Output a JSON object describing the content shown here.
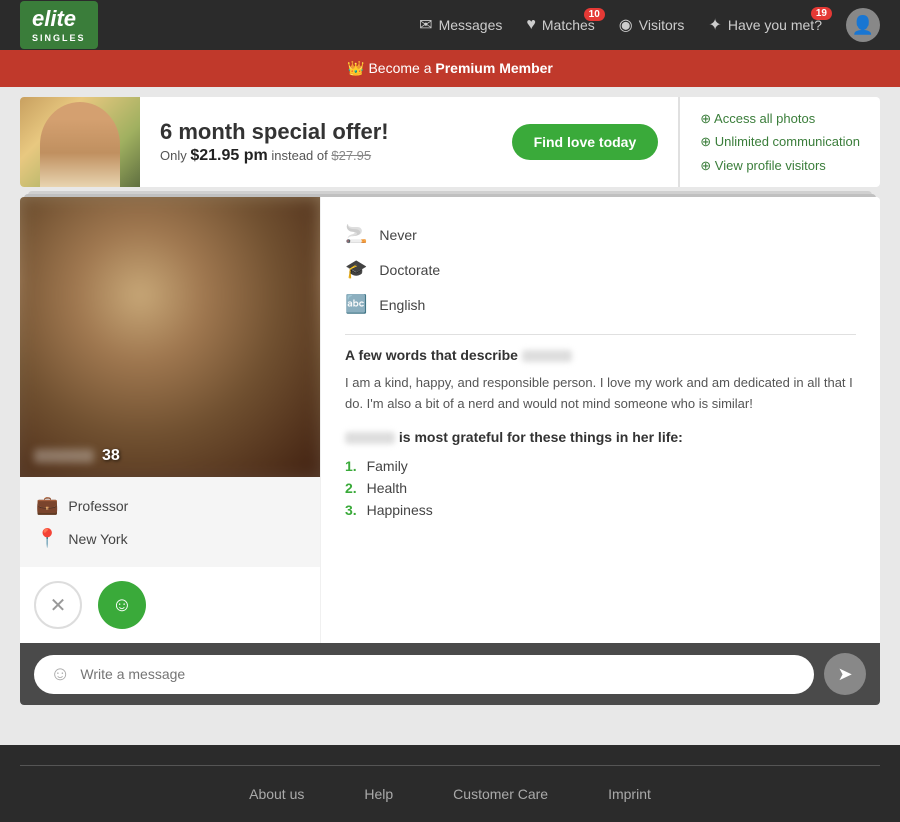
{
  "header": {
    "logo": "elite",
    "logo_sub": "SINGLES",
    "nav": [
      {
        "id": "messages",
        "label": "Messages",
        "icon": "✉",
        "badge": null
      },
      {
        "id": "matches",
        "label": "Matches",
        "icon": "♥",
        "badge": "10"
      },
      {
        "id": "visitors",
        "label": "Visitors",
        "icon": "◉",
        "badge": null
      },
      {
        "id": "have-you-met",
        "label": "Have you met?",
        "icon": "✦",
        "badge": "19"
      }
    ]
  },
  "premium_banner": {
    "text": "Become a ",
    "link_text": "Premium Member",
    "crown_icon": "👑"
  },
  "ad_banner": {
    "title": "6 month special offer!",
    "price_text": "Only ",
    "price": "$21.95 pm",
    "original_price": "$27.95",
    "instead_text": "instead of ",
    "cta_button": "Find love today",
    "features": [
      "Access all photos",
      "Unlimited communication",
      "View profile visitors"
    ]
  },
  "profile": {
    "age": "38",
    "occupation": "Professor",
    "location": "New York",
    "details": [
      {
        "icon": "🚬",
        "text": "Never"
      },
      {
        "icon": "🎓",
        "text": "Doctorate"
      },
      {
        "icon": "🔤",
        "text": "English"
      }
    ],
    "describe_label": "A few words that describe",
    "bio": "I am a kind, happy, and responsible person. I love my work and am dedicated in all that I do. I'm also a bit of a nerd and would not mind someone who is similar!",
    "grateful_label": "is most grateful for these things in her life:",
    "grateful_items": [
      "Family",
      "Health",
      "Happiness"
    ]
  },
  "message_bar": {
    "placeholder": "Write a message"
  },
  "footer": {
    "links": [
      "About us",
      "Help",
      "Customer Care",
      "Imprint"
    ]
  },
  "actions": {
    "reject_icon": "✕",
    "like_icon": "☺",
    "send_icon": "➤"
  }
}
